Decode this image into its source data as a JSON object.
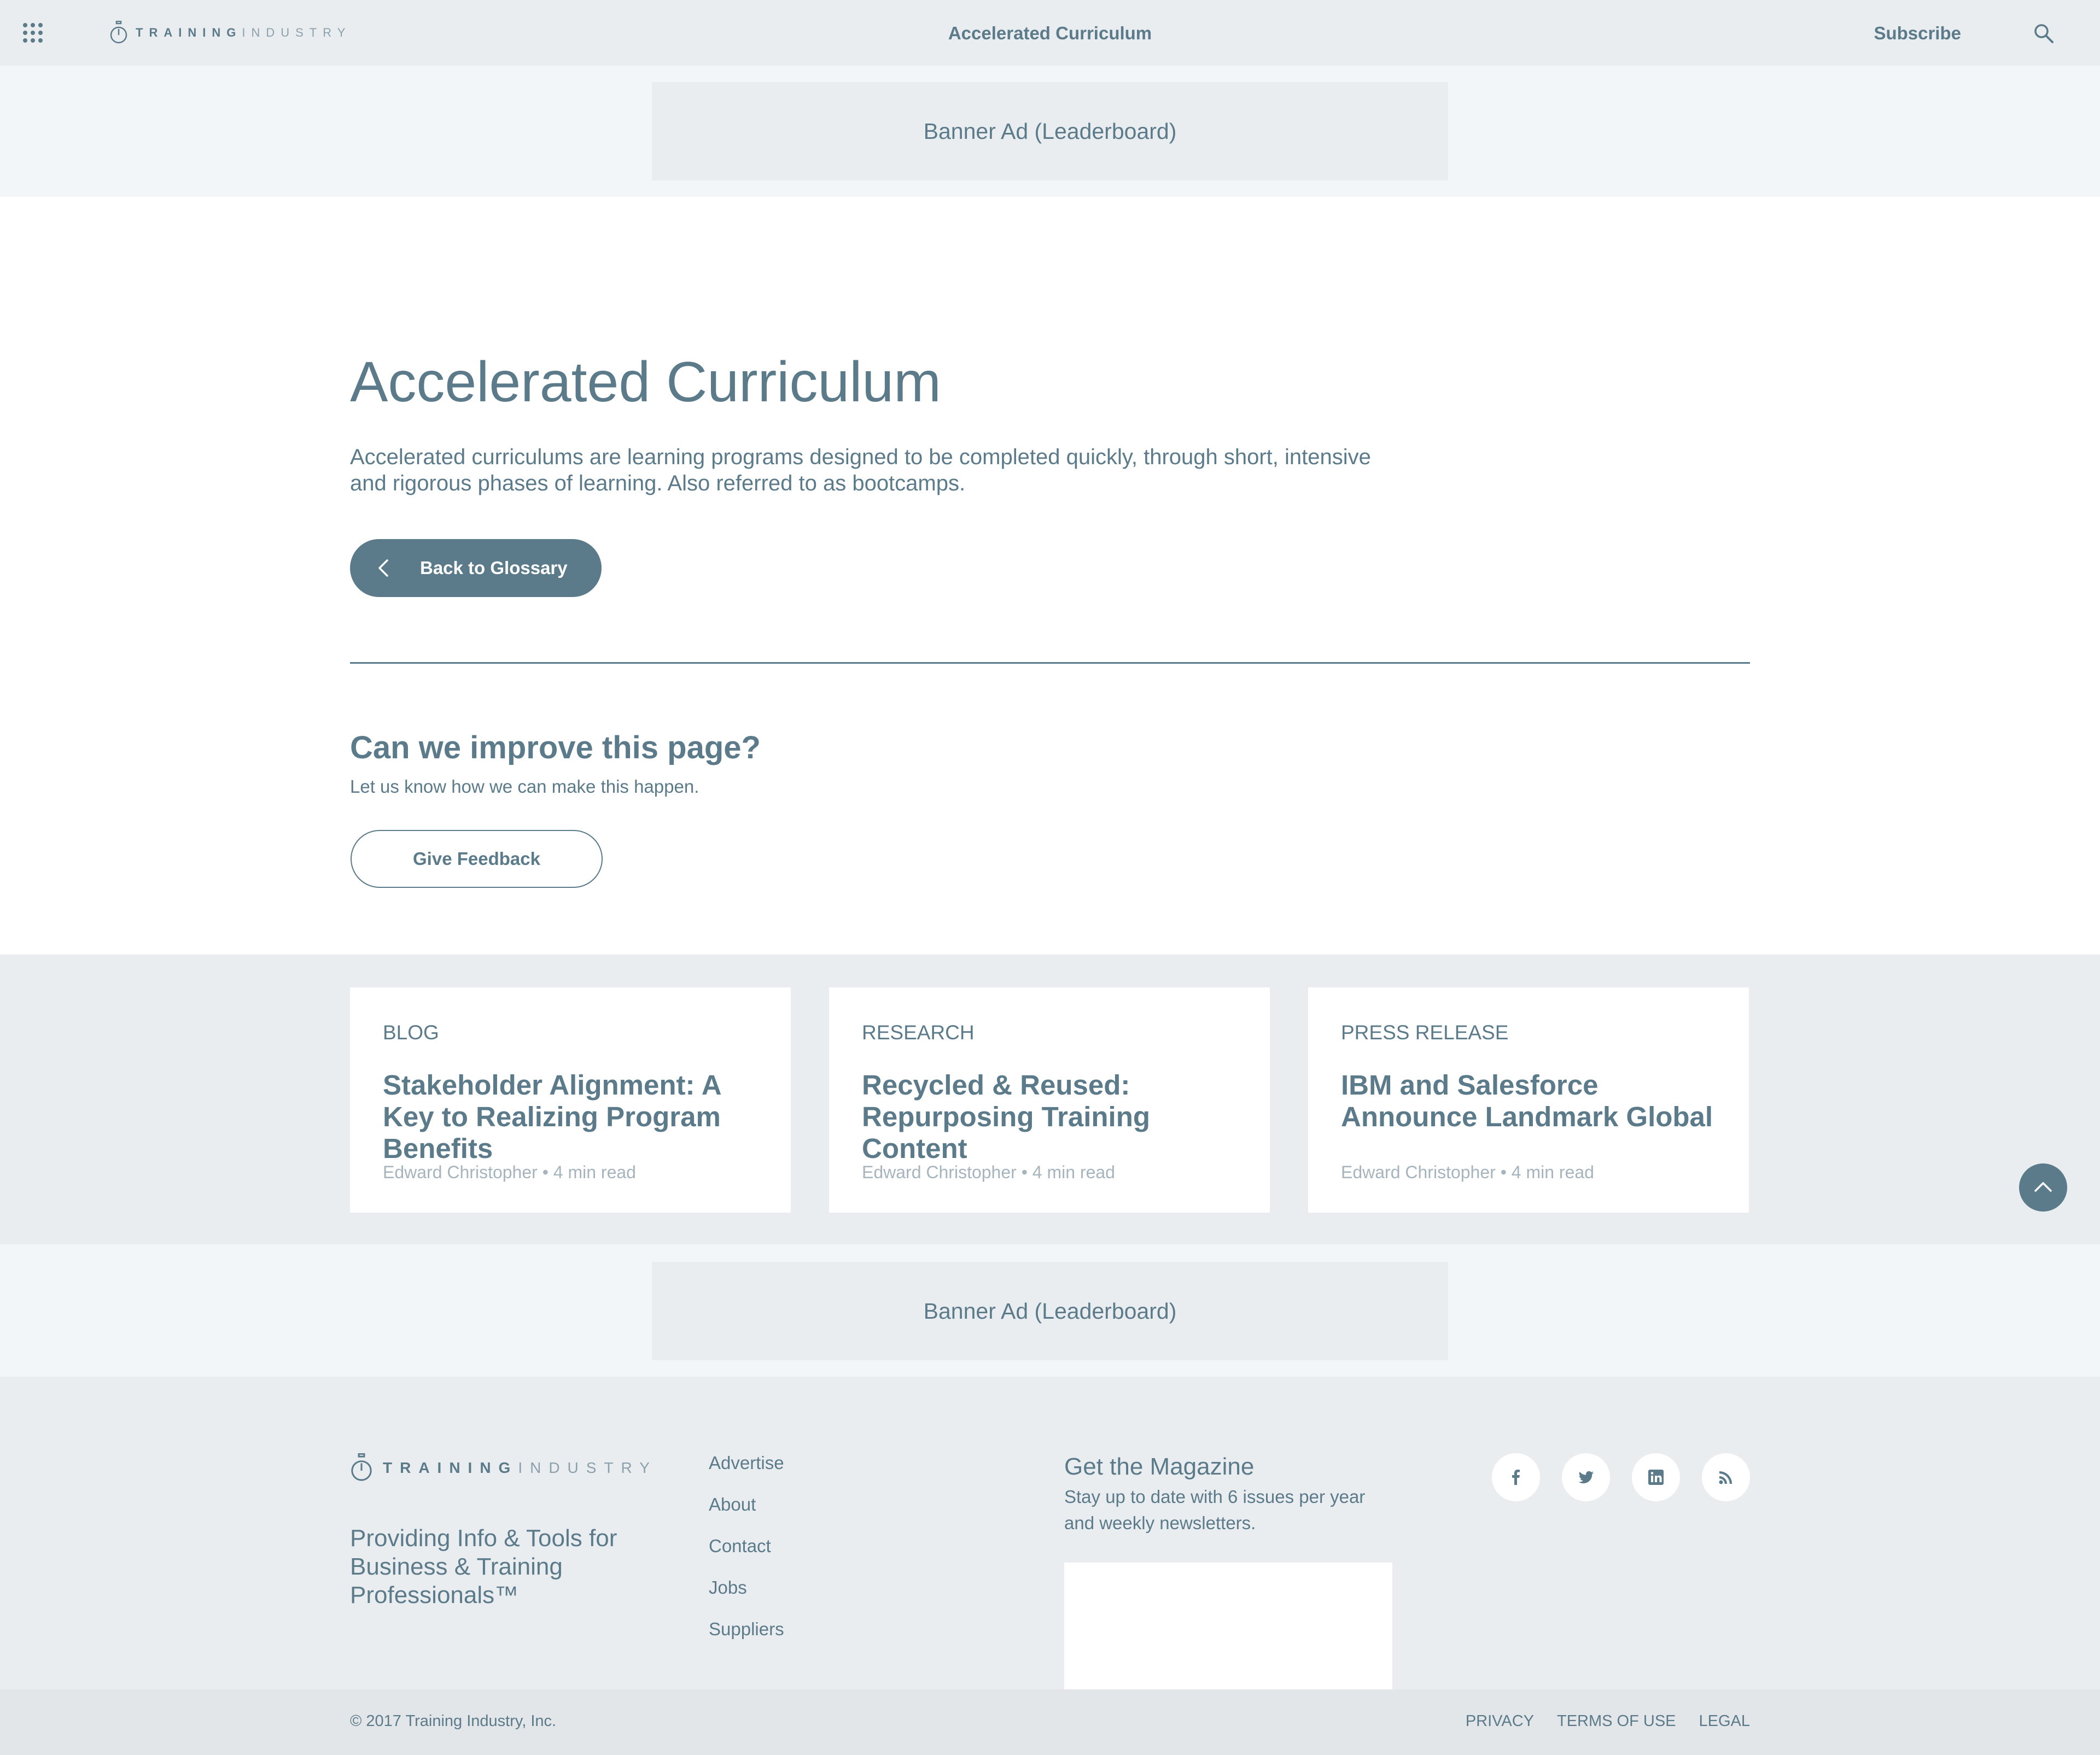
{
  "header": {
    "brand_bold": "TRAINING",
    "brand_light": "INDUSTRY",
    "title": "Accelerated Curriculum",
    "subscribe_label": "Subscribe"
  },
  "ads": {
    "top_label": "Banner Ad (Leaderboard)",
    "bottom_label": "Banner Ad (Leaderboard)"
  },
  "main": {
    "title": "Accelerated Curriculum",
    "definition": "Accelerated curriculums are learning programs designed to be completed quickly, through short, intensive and rigorous phases of learning. Also referred to as bootcamps.",
    "back_label": "Back to Glossary",
    "improve_title": "Can we improve this page?",
    "improve_sub": "Let us know how we can make this happen.",
    "feedback_label": "Give Feedback"
  },
  "related": [
    {
      "category": "BLOG",
      "title": "Stakeholder Alignment: A Key to Realizing Program Benefits",
      "meta": "Edward Christopher • 4 min read"
    },
    {
      "category": "RESEARCH",
      "title": "Recycled & Reused: Repurposing Training Content",
      "meta": "Edward Christopher • 4 min read"
    },
    {
      "category": "PRESS RELEASE",
      "title": "IBM and Salesforce Announce Landmark Global",
      "meta": "Edward Christopher • 4 min read"
    }
  ],
  "footer": {
    "brand_bold": "TRAINING",
    "brand_light": "INDUSTRY",
    "tagline": "Providing Info & Tools for Business & Training Professionals™",
    "links": [
      "Advertise",
      "About",
      "Contact",
      "Jobs",
      "Suppliers"
    ],
    "magazine_title": "Get the Magazine",
    "magazine_sub": "Stay up to date with 6 issues per year and weekly newsletters.",
    "social_icons": [
      "facebook-icon",
      "twitter-icon",
      "linkedin-icon",
      "rss-icon"
    ],
    "copyright": "© 2017 Training Industry, Inc.",
    "legal_links": [
      "PRIVACY",
      "TERMS OF USE",
      "LEGAL"
    ]
  },
  "colors": {
    "primary": "#5b7a8a",
    "nav_bg": "#eaedf0",
    "ad_band_bg": "#f2f6f9",
    "meta_text": "#a5b4bd"
  }
}
